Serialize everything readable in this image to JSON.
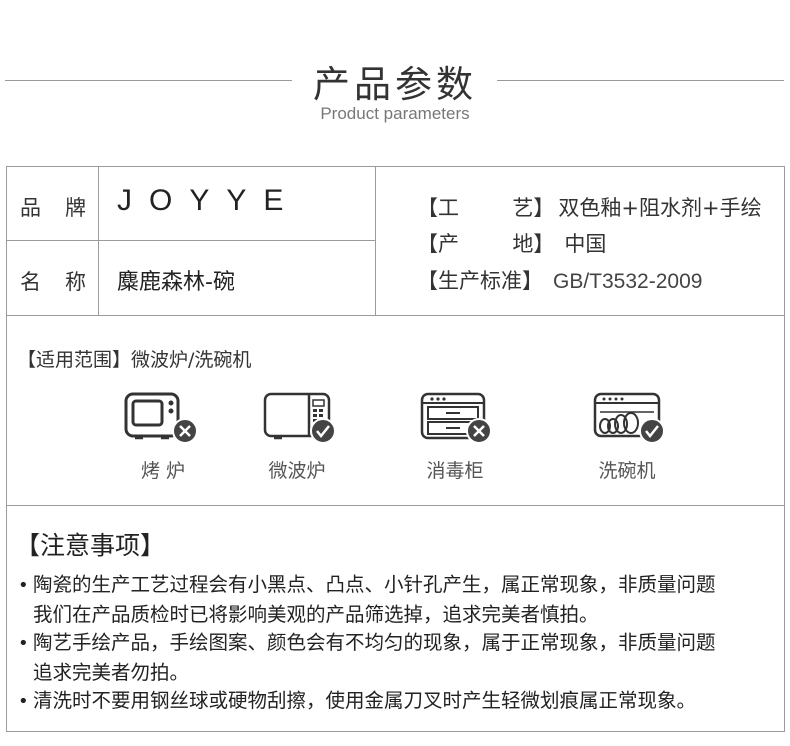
{
  "header": {
    "title": "产品参数",
    "subtitle": "Product parameters"
  },
  "specs": {
    "brand_label_a": "品",
    "brand_label_b": "牌",
    "brand_value": "JOYYE",
    "name_label_a": "名",
    "name_label_b": "称",
    "name_value": "麋鹿森林-碗",
    "craft_key": "【工        艺】",
    "craft_value": "双色釉+阻水剂+手绘",
    "origin_key": "【产        地】",
    "origin_value": "中国",
    "standard_key": "【生产标准】",
    "standard_value": "GB/T3532-2009"
  },
  "usage": {
    "title": "【适用范围】微波炉/洗碗机",
    "appliances": [
      {
        "label": "烤 炉",
        "icon": "oven-icon",
        "status": "not-suitable",
        "status_icon": "cross-badge-icon"
      },
      {
        "label": "微波炉",
        "icon": "microwave-icon",
        "status": "suitable",
        "status_icon": "check-badge-icon"
      },
      {
        "label": "消毒柜",
        "icon": "disinfection-cabinet-icon",
        "status": "not-suitable",
        "status_icon": "cross-badge-icon"
      },
      {
        "label": "洗碗机",
        "icon": "dishwasher-icon",
        "status": "suitable",
        "status_icon": "check-badge-icon"
      }
    ]
  },
  "notes": {
    "title": "【注意事项】",
    "bullet": "•",
    "items": [
      {
        "line1": "陶瓷的生产工艺过程会有小黑点、凸点、小针孔产生，属正常现象，非质量问题",
        "line2": "我们在产品质检时已将影响美观的产品筛选掉，追求完美者慎拍。"
      },
      {
        "line1": "陶艺手绘产品，手绘图案、颜色会有不均匀的现象，属于正常现象，非质量问题",
        "line2": "追求完美者勿拍。"
      },
      {
        "line1": "清洗时不要用钢丝球或硬物刮擦，使用金属刀叉时产生轻微划痕属正常现象。",
        "line2": ""
      }
    ]
  },
  "colors": {
    "border": "#9b9b9b",
    "icon_stroke": "#333333",
    "badge_fill": "#444444"
  }
}
